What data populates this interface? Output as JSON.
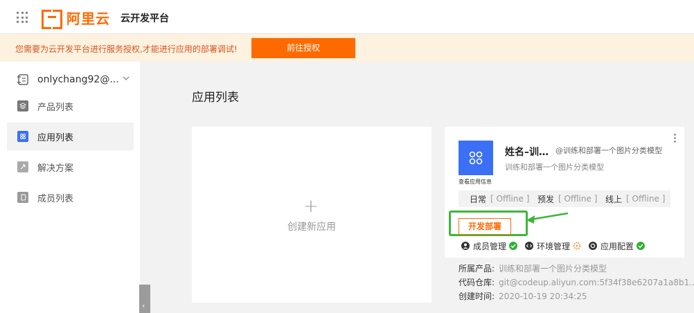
{
  "header": {
    "logo_text": "阿里云",
    "platform_title": "云开发平台"
  },
  "notice": {
    "text": "您需要为云开发平台进行服务授权,才能进行应用的部署调试!",
    "button_label": "前往授权"
  },
  "sidebar": {
    "account_name": "onlychang92@...",
    "items": [
      {
        "label": "产品列表",
        "icon": "product-icon"
      },
      {
        "label": "应用列表",
        "icon": "app-icon",
        "active": true
      },
      {
        "label": "解决方案",
        "icon": "solution-icon"
      },
      {
        "label": "成员列表",
        "icon": "member-icon"
      }
    ]
  },
  "main": {
    "title": "应用列表",
    "create_label": "创建新应用",
    "create_plus": "+",
    "app": {
      "name": "姓名–训…",
      "scope": "@训练和部署一个图片分类模型",
      "description": "训练和部署一个图片分类模型",
      "info_link": "查看应用信息",
      "envs": [
        {
          "label": "日常",
          "status": "[ Offline ]"
        },
        {
          "label": "预发",
          "status": "[ Offline ]"
        },
        {
          "label": "线上",
          "status": "[ Offline ]"
        }
      ],
      "deploy_label": "开发部署",
      "management": [
        {
          "label": "成员管理",
          "icon": "user-icon",
          "status": "ok"
        },
        {
          "label": "环境管理",
          "icon": "code-icon",
          "status": "pending"
        },
        {
          "label": "应用配置",
          "icon": "gear-icon",
          "status": "ok"
        }
      ],
      "details": {
        "product_label": "所属产品:",
        "product_value": "训练和部署一个图片分类模型",
        "repo_label": "代码仓库:",
        "repo_value": "git@codeup.aliyun.com:5f34f38e6207a1a8b1...",
        "created_label": "创建时间:",
        "created_value": "2020-10-19 20:34:25"
      }
    }
  },
  "colors": {
    "brand": "#ff6a00",
    "app_avatar": "#3b6ff5",
    "highlight": "#3cb739",
    "notice_bg": "#fdf2e0"
  }
}
